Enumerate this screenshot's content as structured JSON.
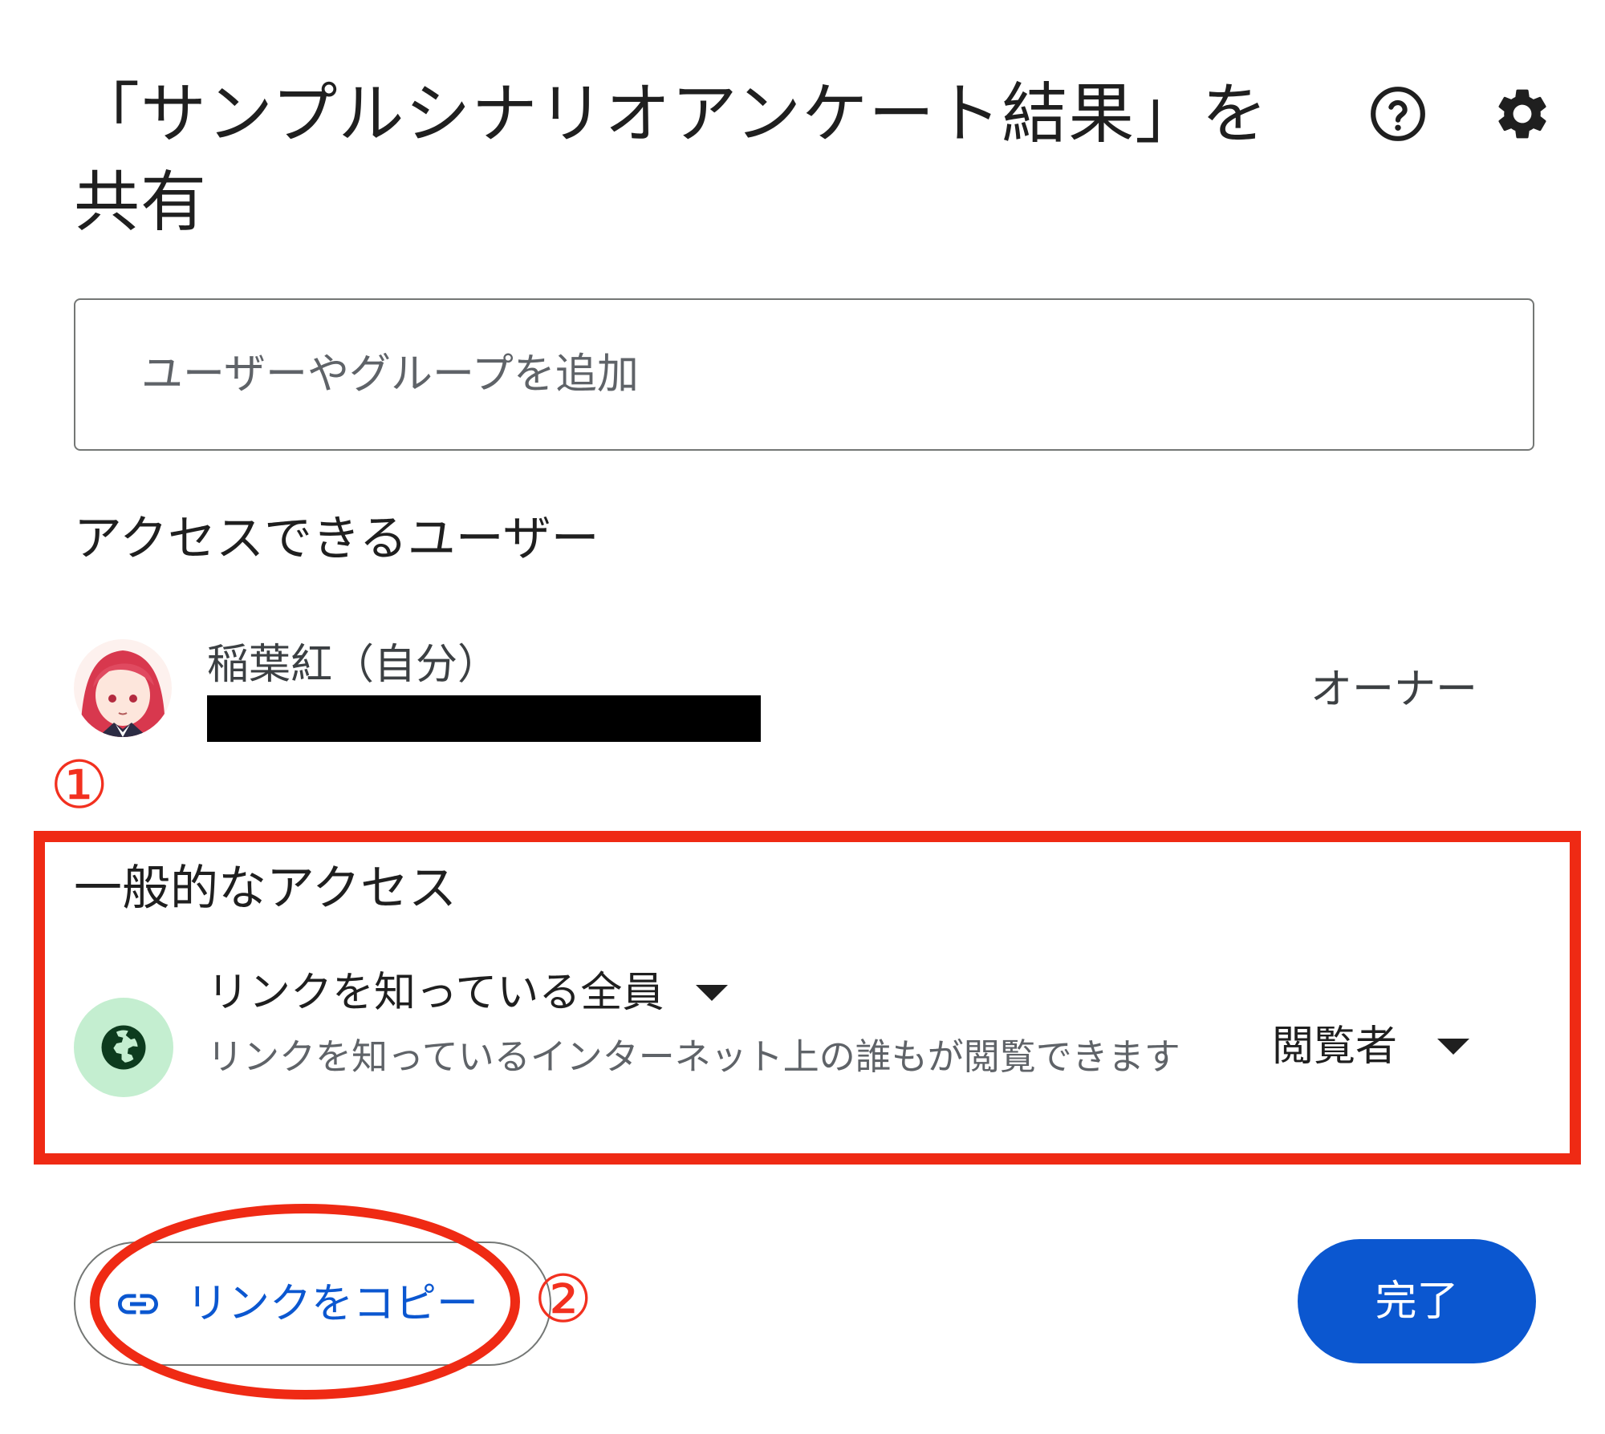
{
  "dialog": {
    "title": "「サンプルシナリオアンケート結果」を共有",
    "help_icon": "help-circle-icon",
    "settings_icon": "gear-icon"
  },
  "search": {
    "placeholder": "ユーザーやグループを追加",
    "value": ""
  },
  "people_section": {
    "title": "アクセスできるユーザー",
    "users": [
      {
        "name": "稲葉紅（自分）",
        "role": "オーナー",
        "avatar": "avatar-image"
      }
    ]
  },
  "annotations": {
    "marker_1": "①",
    "marker_2": "②",
    "highlight_color": "#ef2a14"
  },
  "general_access": {
    "title": "一般的なアクセス",
    "icon": "globe-icon",
    "access_level": "リンクを知っている全員",
    "description": "リンクを知っているインターネット上の誰もが閲覧できます",
    "role": "閲覧者"
  },
  "footer": {
    "copy_link_label": "リンクをコピー",
    "copy_link_icon": "link-icon",
    "done_label": "完了"
  },
  "colors": {
    "accent": "#0b57d0",
    "globe_bg": "#c4eed0",
    "annotation_red": "#ef2a14"
  }
}
